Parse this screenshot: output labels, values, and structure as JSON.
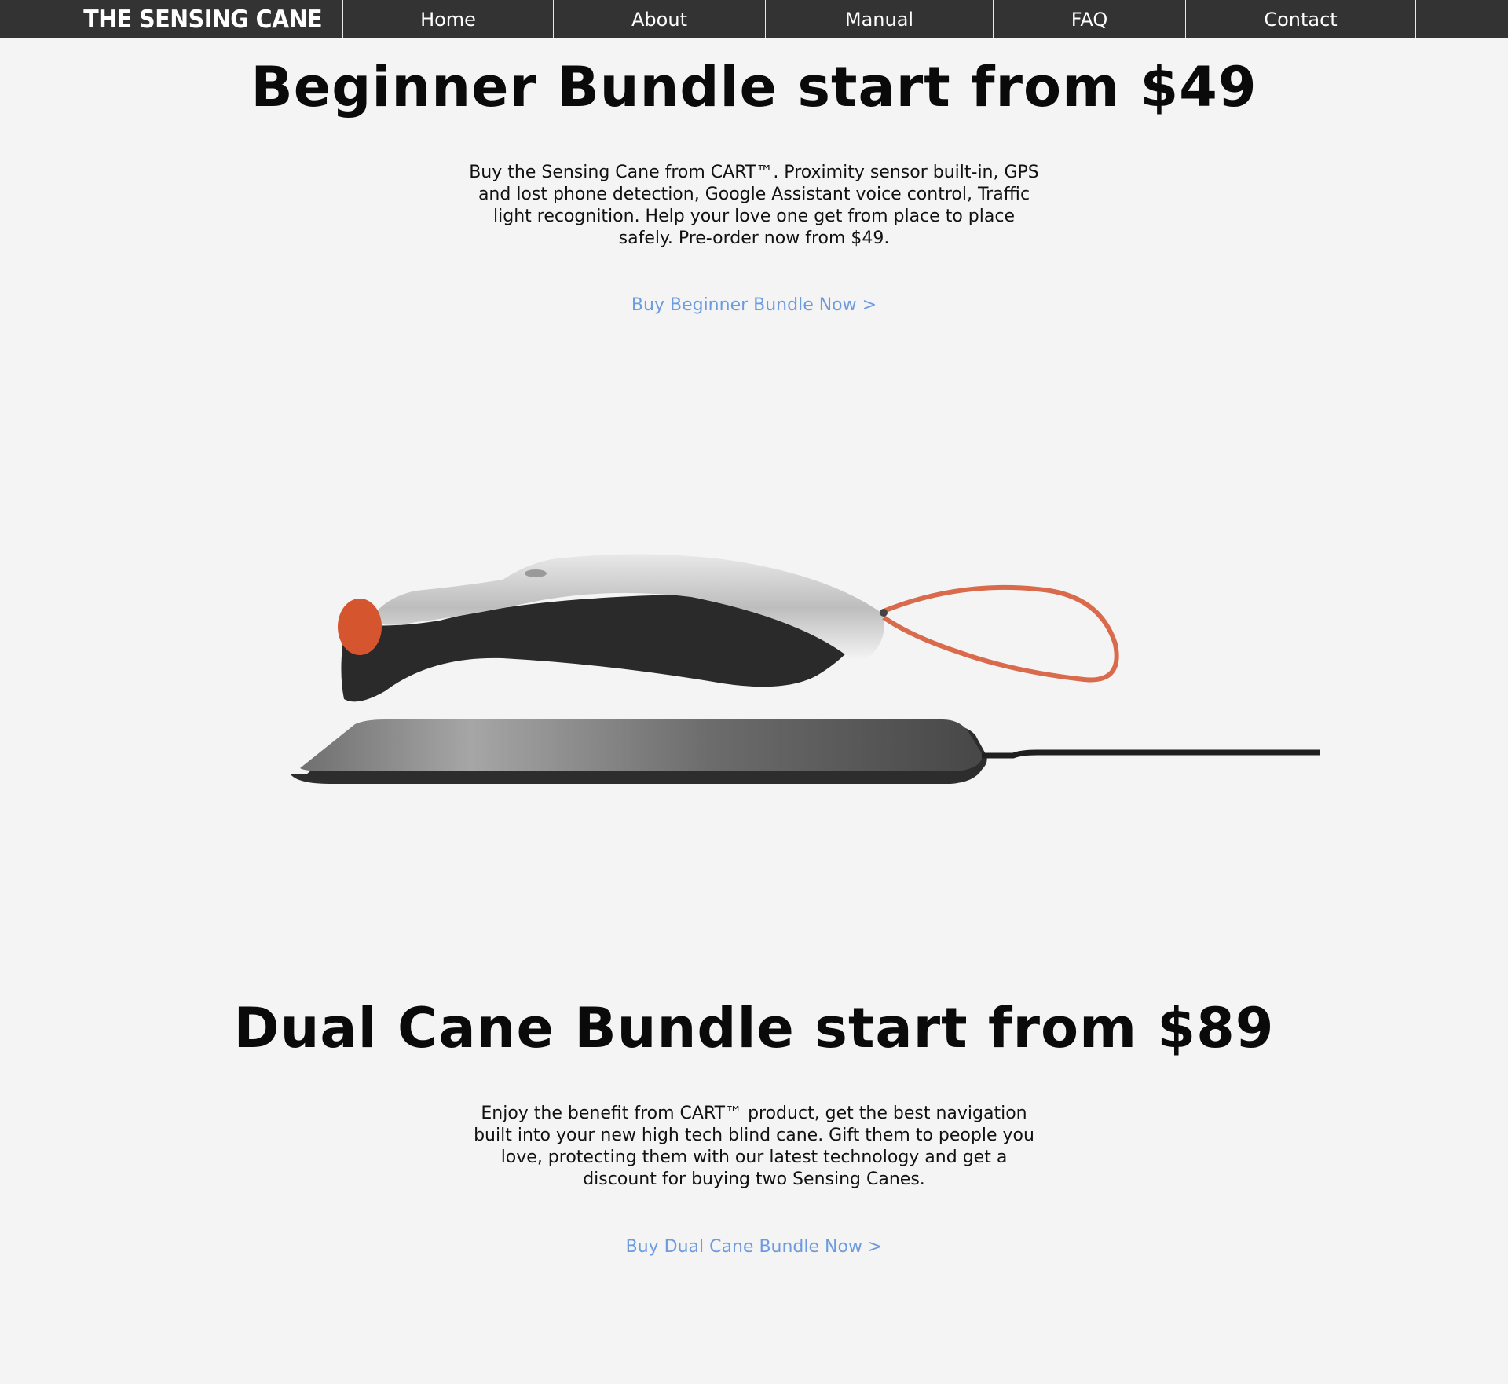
{
  "nav": {
    "brand": "THE SENSING CANE",
    "items": [
      {
        "label": "Home"
      },
      {
        "label": "About"
      },
      {
        "label": "Manual"
      },
      {
        "label": "FAQ"
      },
      {
        "label": "Contact"
      }
    ]
  },
  "beginner": {
    "title": "Beginner Bundle start from $49",
    "description": "Buy the Sensing Cane from CART™. Proximity sensor built-in, GPS and lost phone detection, Google Assistant voice control, Traffic light recognition. Help your love one get from place to place safely. Pre-order now from $49.",
    "cta": "Buy Beginner Bundle Now >"
  },
  "dual": {
    "title": "Dual Cane Bundle start from $89",
    "description": "Enjoy the benefit from CART™ product, get the best navigation built into your new high tech blind cane. Gift them to people you love, protecting them with our latest technology and get a discount for buying two Sensing Canes.",
    "cta": "Buy Dual Cane Bundle Now >"
  },
  "colors": {
    "nav_bg": "#333333",
    "page_bg": "#f4f4f4",
    "link": "#6c9be0",
    "accent_orange": "#d4552e"
  }
}
